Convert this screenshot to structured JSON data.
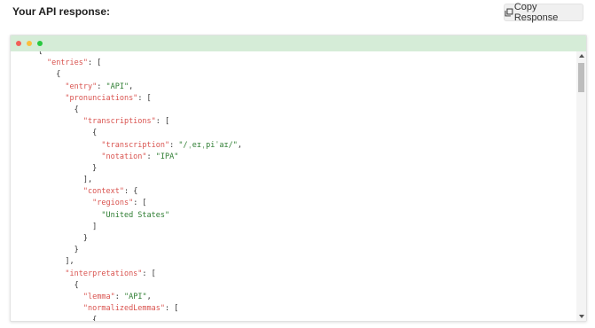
{
  "header": {
    "title": "Your API response:",
    "copy_label": "Copy Response"
  },
  "window": {
    "dots": [
      "#f25f58",
      "#fbbe3c",
      "#29c840"
    ],
    "titlebar_color": "#d5ecd7"
  },
  "code_lines": [
    {
      "indent": 6,
      "parts": [
        {
          "t": "{",
          "c": "p"
        }
      ]
    },
    {
      "indent": 8,
      "parts": [
        {
          "t": "\"entries\"",
          "c": "k"
        },
        {
          "t": ": [",
          "c": "p"
        }
      ]
    },
    {
      "indent": 10,
      "parts": [
        {
          "t": "{",
          "c": "p"
        }
      ]
    },
    {
      "indent": 12,
      "parts": [
        {
          "t": "\"entry\"",
          "c": "k"
        },
        {
          "t": ": ",
          "c": "p"
        },
        {
          "t": "\"API\"",
          "c": "s"
        },
        {
          "t": ",",
          "c": "p"
        }
      ]
    },
    {
      "indent": 12,
      "parts": [
        {
          "t": "\"pronunciations\"",
          "c": "k"
        },
        {
          "t": ": [",
          "c": "p"
        }
      ]
    },
    {
      "indent": 14,
      "parts": [
        {
          "t": "{",
          "c": "p"
        }
      ]
    },
    {
      "indent": 16,
      "parts": [
        {
          "t": "\"transcriptions\"",
          "c": "k"
        },
        {
          "t": ": [",
          "c": "p"
        }
      ]
    },
    {
      "indent": 18,
      "parts": [
        {
          "t": "{",
          "c": "p"
        }
      ]
    },
    {
      "indent": 20,
      "parts": [
        {
          "t": "\"transcription\"",
          "c": "k"
        },
        {
          "t": ": ",
          "c": "p"
        },
        {
          "t": "\"/ˌeɪˌpiˈaɪ/\"",
          "c": "s"
        },
        {
          "t": ",",
          "c": "p"
        }
      ]
    },
    {
      "indent": 20,
      "parts": [
        {
          "t": "\"notation\"",
          "c": "k"
        },
        {
          "t": ": ",
          "c": "p"
        },
        {
          "t": "\"IPA\"",
          "c": "s"
        }
      ]
    },
    {
      "indent": 18,
      "parts": [
        {
          "t": "}",
          "c": "p"
        }
      ]
    },
    {
      "indent": 16,
      "parts": [
        {
          "t": "],",
          "c": "p"
        }
      ]
    },
    {
      "indent": 16,
      "parts": [
        {
          "t": "\"context\"",
          "c": "k"
        },
        {
          "t": ": {",
          "c": "p"
        }
      ]
    },
    {
      "indent": 18,
      "parts": [
        {
          "t": "\"regions\"",
          "c": "k"
        },
        {
          "t": ": [",
          "c": "p"
        }
      ]
    },
    {
      "indent": 20,
      "parts": [
        {
          "t": "\"United States\"",
          "c": "s"
        }
      ]
    },
    {
      "indent": 18,
      "parts": [
        {
          "t": "]",
          "c": "p"
        }
      ]
    },
    {
      "indent": 16,
      "parts": [
        {
          "t": "}",
          "c": "p"
        }
      ]
    },
    {
      "indent": 14,
      "parts": [
        {
          "t": "}",
          "c": "p"
        }
      ]
    },
    {
      "indent": 12,
      "parts": [
        {
          "t": "],",
          "c": "p"
        }
      ]
    },
    {
      "indent": 12,
      "parts": [
        {
          "t": "\"interpretations\"",
          "c": "k"
        },
        {
          "t": ": [",
          "c": "p"
        }
      ]
    },
    {
      "indent": 14,
      "parts": [
        {
          "t": "{",
          "c": "p"
        }
      ]
    },
    {
      "indent": 16,
      "parts": [
        {
          "t": "\"lemma\"",
          "c": "k"
        },
        {
          "t": ": ",
          "c": "p"
        },
        {
          "t": "\"API\"",
          "c": "s"
        },
        {
          "t": ",",
          "c": "p"
        }
      ]
    },
    {
      "indent": 16,
      "parts": [
        {
          "t": "\"normalizedLemmas\"",
          "c": "k"
        },
        {
          "t": ": [",
          "c": "p"
        }
      ]
    },
    {
      "indent": 18,
      "parts": [
        {
          "t": "{",
          "c": "p"
        }
      ]
    }
  ]
}
